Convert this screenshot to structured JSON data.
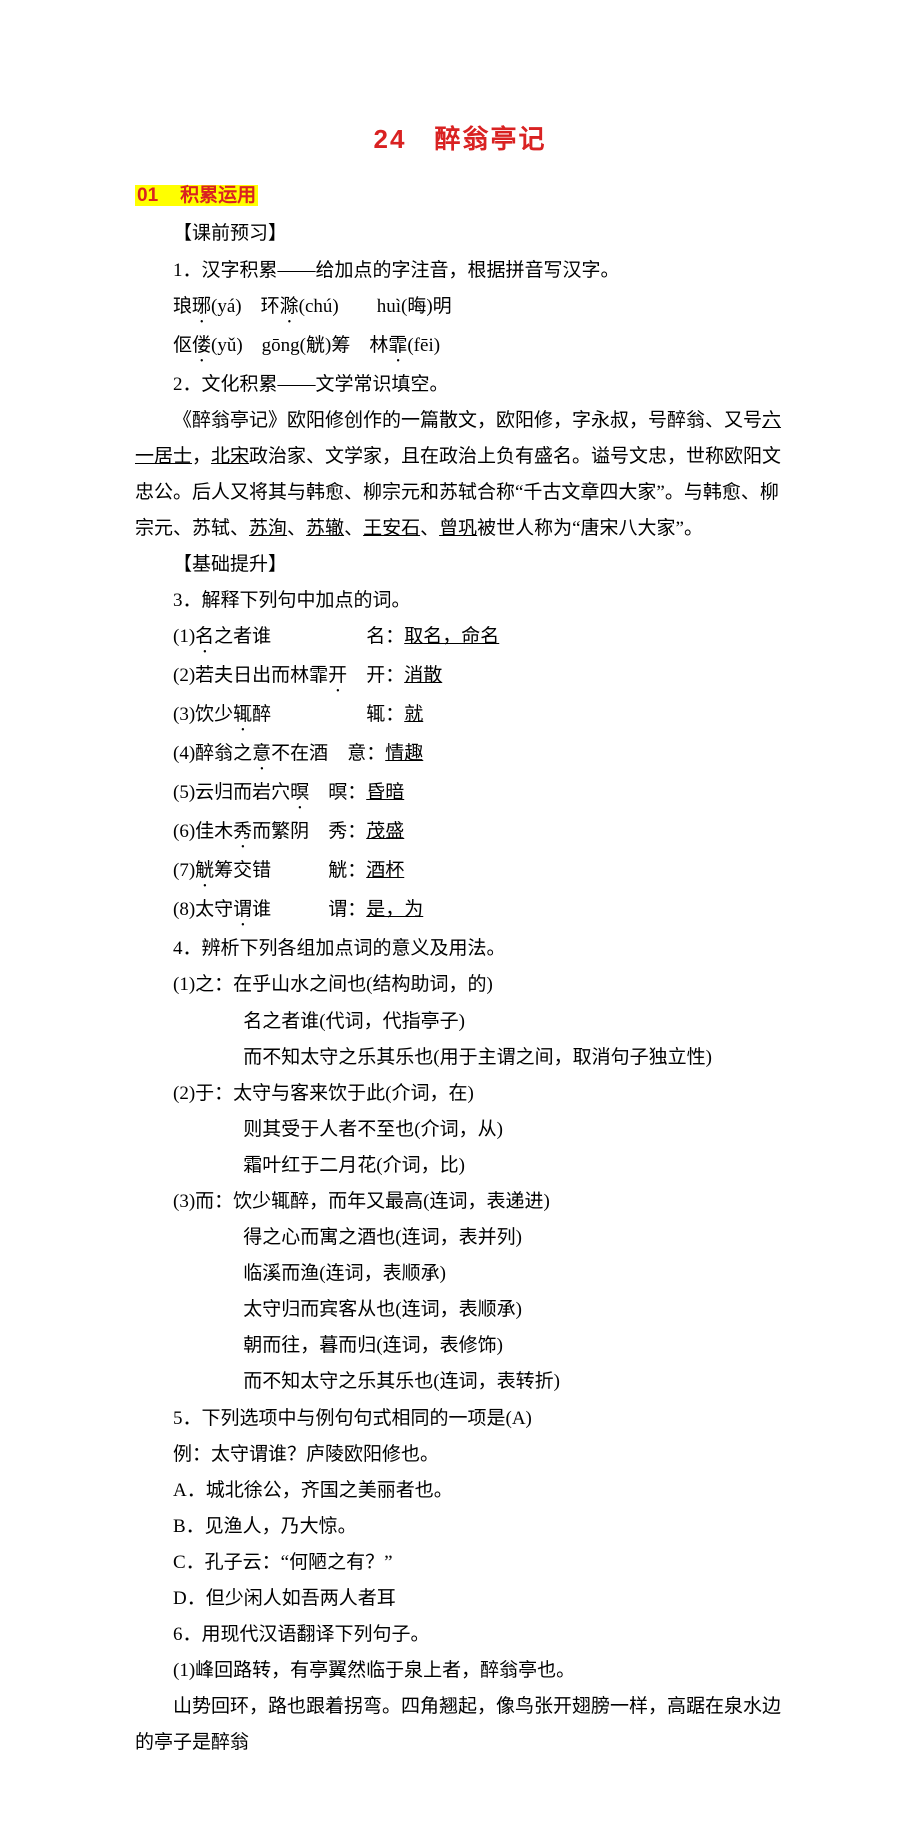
{
  "title": "24　醉翁亭记",
  "section1": {
    "num": "01",
    "label": "积累运用"
  },
  "sub_keqian": "【课前预习】",
  "q1": {
    "stem": "1．汉字积累——给加点的字注音，根据拼音写汉字。",
    "line1_a": "琅",
    "line1_b": "(yá)　环",
    "line1_c": "(chú)　　huì(晦)明",
    "line2_a": "伛",
    "line2_b": "(yǔ)　gōng(觥)筹　林",
    "line2_c": "(fēi)",
    "d1": "琊",
    "d2": "滁",
    "d3": "偻",
    "d4": "霏"
  },
  "q2": {
    "stem": "2．文化积累——文学常识填空。",
    "t1": "《醉翁亭记》欧阳修创作的一篇散文，欧阳修，字永叔，号醉翁、又号",
    "u1": "六一居士",
    "t2": "，",
    "u2": "北宋",
    "t3": "政治家、文学家，且在政治上负有盛名。谥号文忠，世称欧阳文忠公。后人又将其与韩愈、柳宗元和苏轼合称“千古文章四大家”。与韩愈、柳宗元、苏轼、",
    "u3": "苏洵",
    "t4": "、",
    "u4": "苏辙",
    "t5": "、",
    "u5": "王安石",
    "t6": "、",
    "u6": "曾巩",
    "t7": "被世人称为“唐宋八大家”。"
  },
  "sub_jichu": "【基础提升】",
  "q3": {
    "stem": "3．解释下列句中加点的词。",
    "items": [
      {
        "pre": "(1)",
        "a": "之者谁",
        "sp": "　　　　　",
        "b": "：",
        "ans": "取名，命名",
        "dot": "名",
        "label": "名"
      },
      {
        "pre": "(2)若夫日出而林霏",
        "a": "",
        "sp": "　",
        "b": "：",
        "ans": "消散",
        "dot": "开",
        "label": "开"
      },
      {
        "pre": "(3)饮少",
        "a": "醉",
        "sp": "　　　　　",
        "b": "：",
        "ans": "就",
        "dot": "辄",
        "label": "辄"
      },
      {
        "pre": "(4)醉翁之",
        "a": "不在酒",
        "sp": "　",
        "b": "：",
        "ans": "情趣",
        "dot": "意",
        "label": "意"
      },
      {
        "pre": "(5)云归而岩穴",
        "a": "",
        "sp": "　",
        "b": "：",
        "ans": "昏暗",
        "dot": "暝",
        "label": "暝"
      },
      {
        "pre": "(6)佳木",
        "a": "而繁阴",
        "sp": "　",
        "b": "：",
        "ans": "茂盛",
        "dot": "秀",
        "label": "秀"
      },
      {
        "pre": "(7)",
        "a": "筹交错",
        "sp": "　　　",
        "b": "：",
        "ans": "酒杯",
        "dot": "觥",
        "label": "觥"
      },
      {
        "pre": "(8)太守",
        "a": "谁",
        "sp": "　　　",
        "b": "：",
        "ans": "是，为",
        "dot": "谓",
        "label": "谓"
      }
    ]
  },
  "q4": {
    "stem": "4．辨析下列各组加点词的意义及用法。",
    "g1": {
      "head": "(1)之：",
      "l1": "在乎山水之间也(结构助词，的)",
      "l2": "名之者谁(代词，代指亭子)",
      "l3": "而不知太守之乐其乐也(用于主谓之间，取消句子独立性)"
    },
    "g2": {
      "head": "(2)于：",
      "l1": "太守与客来饮于此(介词，在)",
      "l2": "则其受于人者不至也(介词，从)",
      "l3": "霜叶红于二月花(介词，比)"
    },
    "g3": {
      "head": "(3)而：",
      "l1": "饮少辄醉，而年又最高(连词，表递进)",
      "l2": "得之心而寓之酒也(连词，表并列)",
      "l3": "临溪而渔(连词，表顺承)",
      "l4": "太守归而宾客从也(连词，表顺承)",
      "l5": "朝而往，暮而归(连词，表修饰)",
      "l6": "而不知太守之乐其乐也(连词，表转折)"
    }
  },
  "q5": {
    "stem": "5．下列选项中与例句句式相同的一项是(A)",
    "ex": "例：太守谓谁？庐陵欧阳修也。",
    "a": "A．城北徐公，齐国之美丽者也。",
    "b": "B．见渔人，乃大惊。",
    "c": "C．孔子云：“何陋之有？”",
    "d": "D．但少闲人如吾两人者耳"
  },
  "q6": {
    "stem": "6．用现代汉语翻译下列句子。",
    "i1": "(1)峰回路转，有亭翼然临于泉上者，醉翁亭也。",
    "a1": "山势回环，路也跟着拐弯。四角翘起，像鸟张开翅膀一样，高踞在泉水边的亭子是醉翁"
  }
}
